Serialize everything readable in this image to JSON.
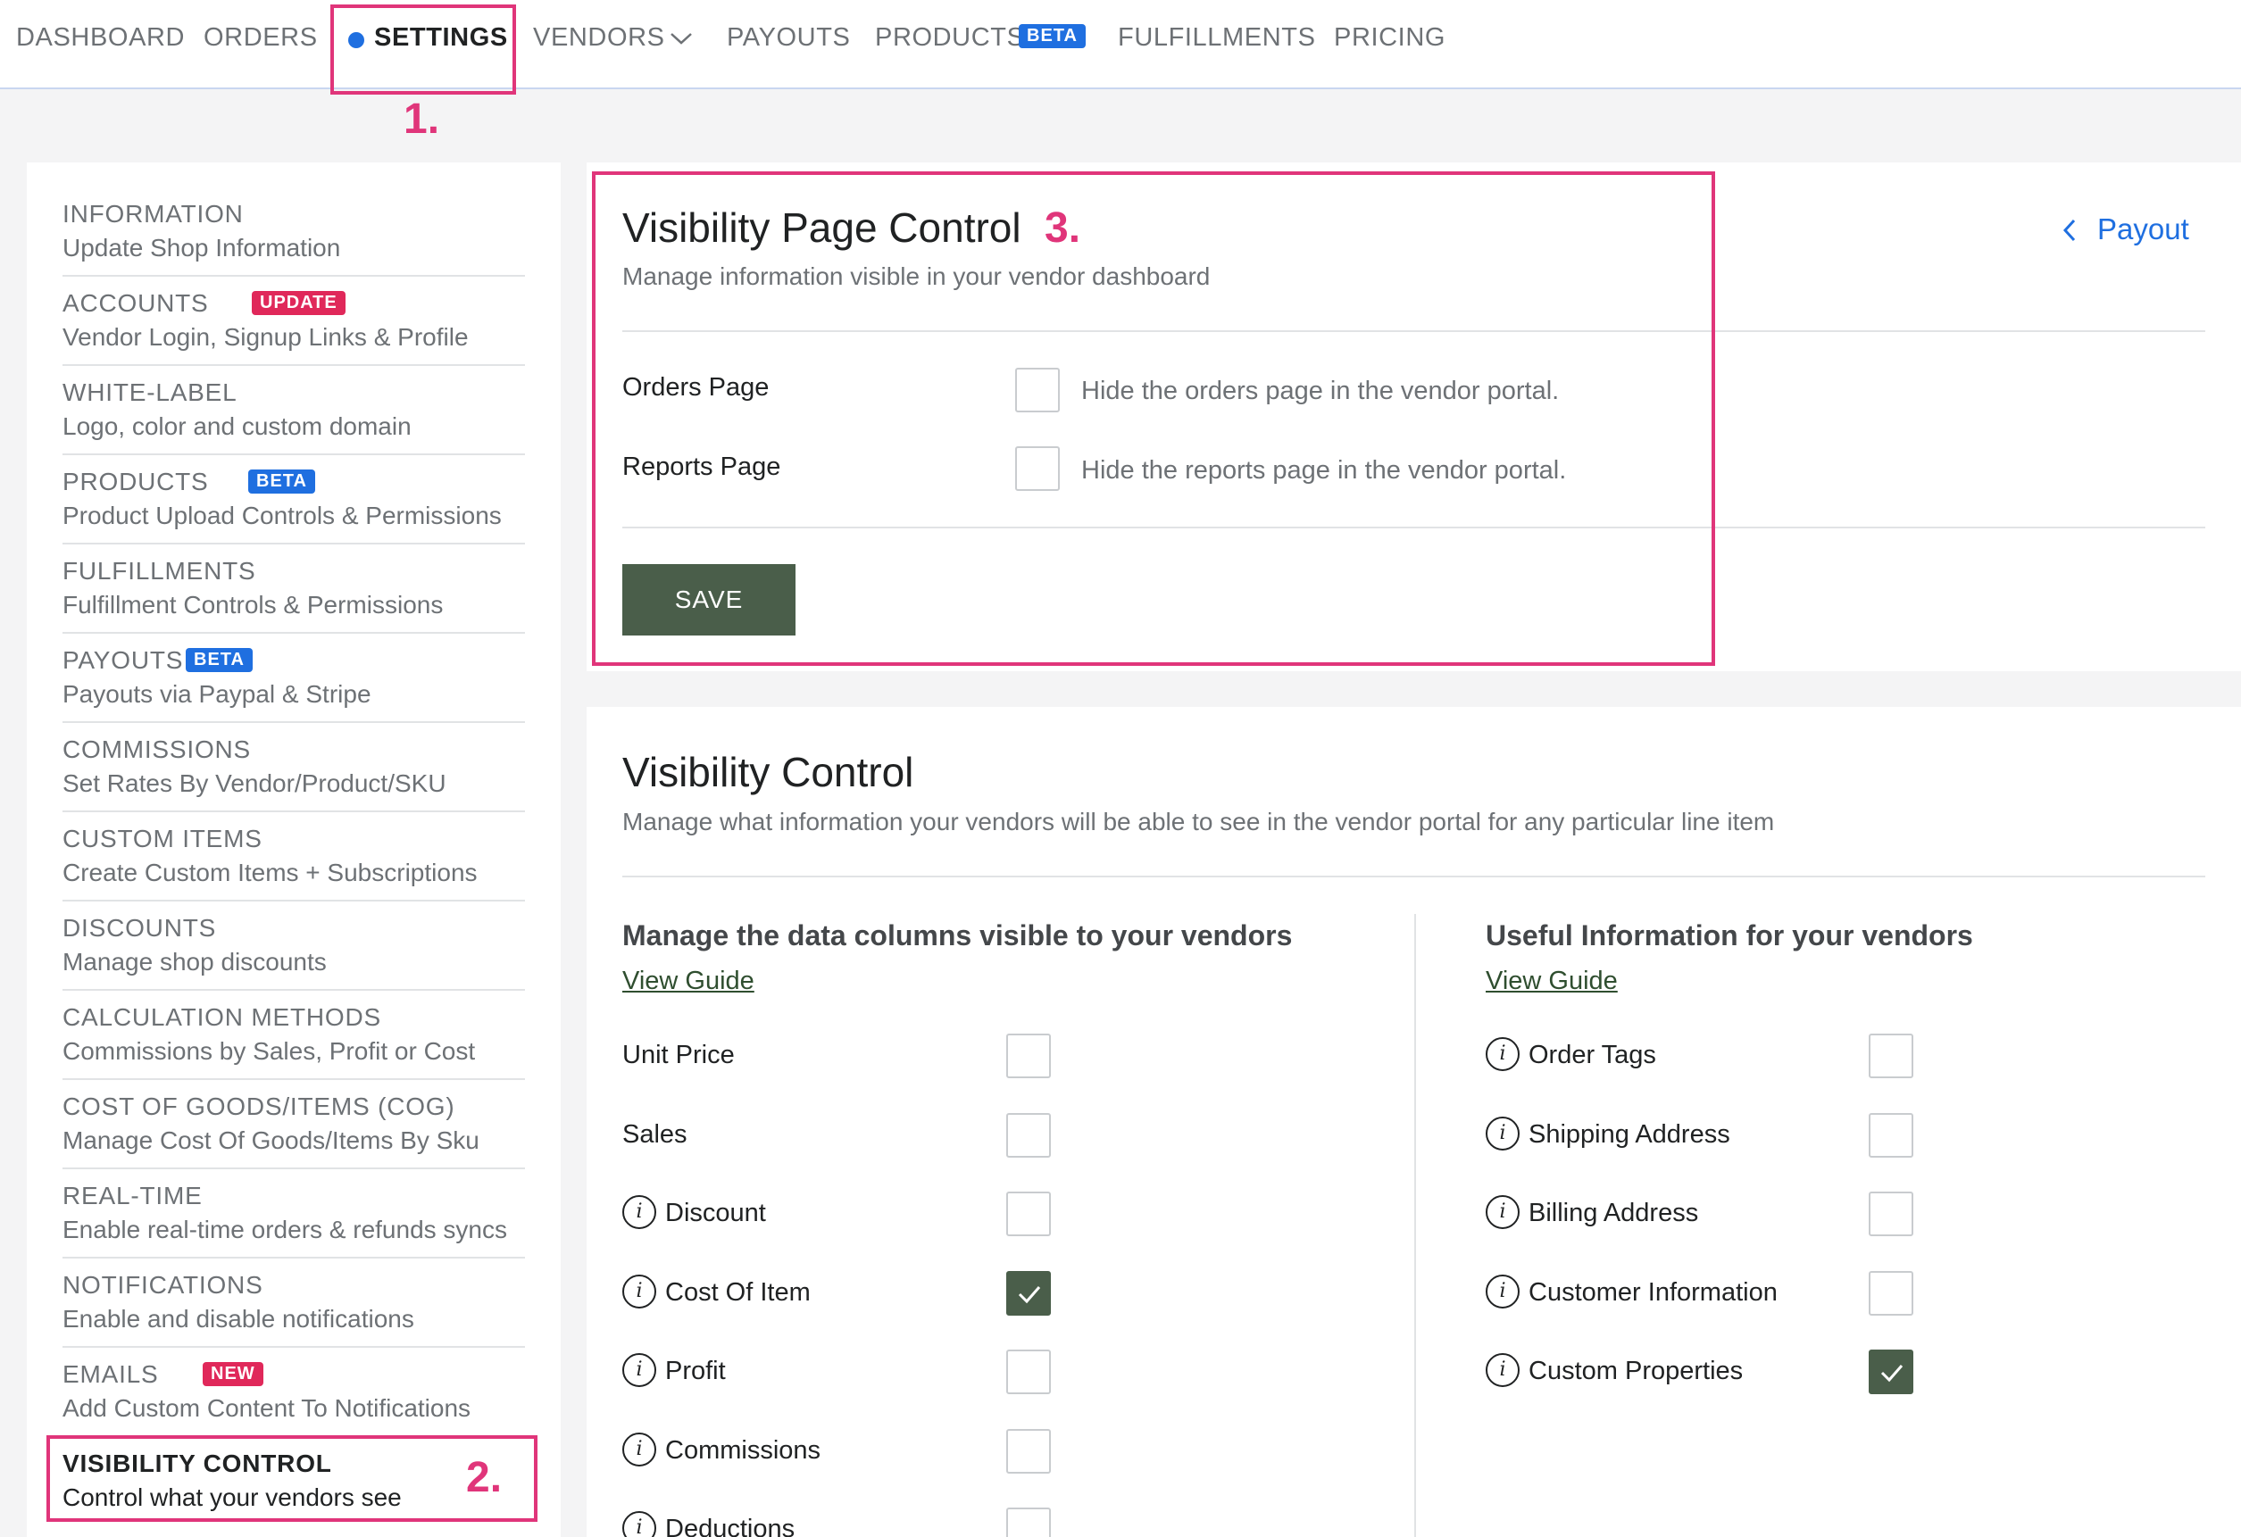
{
  "nav": {
    "items": [
      {
        "label": "DASHBOARD"
      },
      {
        "label": "ORDERS"
      },
      {
        "label": "SETTINGS"
      },
      {
        "label": "VENDORS"
      },
      {
        "label": "PAYOUTS"
      },
      {
        "label": "PRODUCTS",
        "badge": "BETA"
      },
      {
        "label": "FULFILLMENTS"
      },
      {
        "label": "PRICING"
      }
    ],
    "active": "SETTINGS"
  },
  "annotations": [
    "1.",
    "2.",
    "3."
  ],
  "sidebar": {
    "items": [
      {
        "title": "INFORMATION",
        "subtitle": "Update Shop Information"
      },
      {
        "title": "ACCOUNTS",
        "badge": "UPDATE",
        "subtitle": "Vendor Login, Signup Links & Profile"
      },
      {
        "title": "WHITE-LABEL",
        "subtitle": "Logo, color and custom domain"
      },
      {
        "title": "PRODUCTS",
        "badge": "BETA",
        "subtitle": "Product Upload Controls & Permissions"
      },
      {
        "title": "FULFILLMENTS",
        "subtitle": "Fulfillment Controls & Permissions"
      },
      {
        "title": "PAYOUTS",
        "badge": "BETA",
        "subtitle": "Payouts via Paypal & Stripe"
      },
      {
        "title": "COMMISSIONS",
        "subtitle": "Set Rates By Vendor/Product/SKU"
      },
      {
        "title": "CUSTOM ITEMS",
        "subtitle": "Create Custom Items + Subscriptions"
      },
      {
        "title": "DISCOUNTS",
        "subtitle": "Manage shop discounts"
      },
      {
        "title": "CALCULATION METHODS",
        "subtitle": "Commissions by Sales, Profit or Cost"
      },
      {
        "title": "COST OF GOODS/ITEMS (COG)",
        "subtitle": "Manage Cost Of Goods/Items By Sku"
      },
      {
        "title": "REAL-TIME",
        "subtitle": "Enable real-time orders & refunds syncs"
      },
      {
        "title": "NOTIFICATIONS",
        "subtitle": "Enable and disable notifications"
      },
      {
        "title": "EMAILS",
        "badge": "NEW",
        "subtitle": "Add Custom Content To Notifications"
      },
      {
        "title": "VISIBILITY CONTROL",
        "subtitle": "Control what your vendors see"
      }
    ],
    "active": "VISIBILITY CONTROL"
  },
  "page_control": {
    "title": "Visibility Page Control",
    "subtitle": "Manage information visible in your vendor dashboard",
    "back_link": "Payout",
    "rows": [
      {
        "label": "Orders Page",
        "hint": "Hide the orders page in the vendor portal.",
        "checked": false
      },
      {
        "label": "Reports Page",
        "hint": "Hide the reports page in the vendor portal.",
        "checked": false
      }
    ],
    "save_label": "SAVE"
  },
  "visibility_control": {
    "title": "Visibility Control",
    "subtitle": "Manage what information your vendors will be able to see in the vendor portal for any particular line item",
    "left": {
      "heading": "Manage the data columns visible to your vendors",
      "guide": "View Guide",
      "rows": [
        {
          "label": "Unit Price",
          "info": false,
          "checked": false
        },
        {
          "label": "Sales",
          "info": false,
          "checked": false
        },
        {
          "label": "Discount",
          "info": true,
          "checked": false
        },
        {
          "label": "Cost Of Item",
          "info": true,
          "checked": true
        },
        {
          "label": "Profit",
          "info": true,
          "checked": false
        },
        {
          "label": "Commissions",
          "info": true,
          "checked": false
        },
        {
          "label": "Deductions",
          "info": true,
          "checked": false
        }
      ]
    },
    "right": {
      "heading": "Useful Information for your vendors",
      "guide": "View Guide",
      "rows": [
        {
          "label": "Order Tags",
          "info": true,
          "checked": false
        },
        {
          "label": "Shipping Address",
          "info": true,
          "checked": false
        },
        {
          "label": "Billing Address",
          "info": true,
          "checked": false
        },
        {
          "label": "Customer Information",
          "info": true,
          "checked": false
        },
        {
          "label": "Custom Properties",
          "info": true,
          "checked": true
        }
      ]
    }
  },
  "colors": {
    "accent_blue": "#1f6fe0",
    "annotation_pink": "#e0357a",
    "primary_green": "#4a5e4a",
    "badge_red": "#e0285a"
  },
  "icons": {
    "info": "i",
    "check": "check-icon",
    "chevron_down": "chevron-down-icon",
    "chevron_left": "chevron-left-icon"
  }
}
